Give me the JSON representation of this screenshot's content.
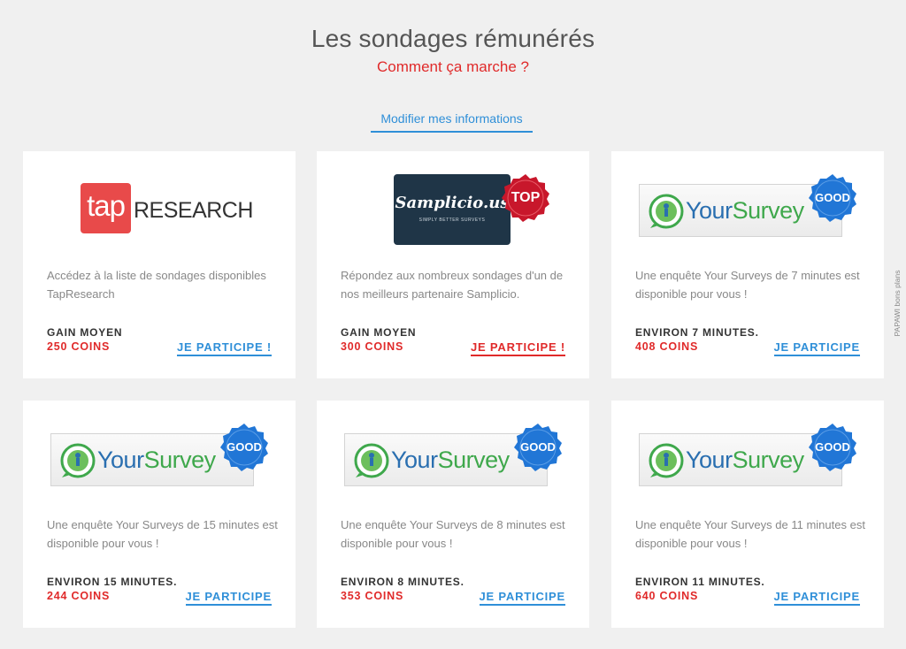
{
  "header": {
    "title": "Les sondages rémunérés",
    "how_link": "Comment ça marche ?",
    "modify_link": "Modifier mes informations"
  },
  "side_brand": "PAPAWI bons plans",
  "colors": {
    "accent_blue": "#2f8fd8",
    "accent_red": "#e02a2a",
    "badge_blue": "#2176d6",
    "badge_red": "#c8172b"
  },
  "cards": [
    {
      "logo": {
        "type": "tap",
        "box_text": "tap",
        "text": "RESEARCH"
      },
      "description": "Accédez à la liste de sondages disponibles TapResearch",
      "label": "GAIN MOYEN",
      "coins": "250 COINS",
      "cta": "JE PARTICIPE !"
    },
    {
      "logo": {
        "type": "samplicio",
        "name": "Samplicio.us",
        "tagline": "SIMPLY BETTER SURVEYS",
        "badge": "TOP"
      },
      "description": "Répondez aux nombreux sondages d'un de nos meilleurs partenaire Samplicio.",
      "label": "GAIN MOYEN",
      "coins": "300 COINS",
      "cta": "JE PARTICIPE !"
    },
    {
      "logo": {
        "type": "yoursurveys",
        "your": "Your",
        "survey": "Survey",
        "badge": "GOOD"
      },
      "description": "Une enquête Your Surveys de 7 minutes est disponible pour vous !",
      "label": "ENVIRON 7 MINUTES.",
      "coins": "408 COINS",
      "cta": "JE PARTICIPE"
    },
    {
      "logo": {
        "type": "yoursurveys",
        "your": "Your",
        "survey": "Survey",
        "badge": "GOOD"
      },
      "description": "Une enquête Your Surveys de 15 minutes est disponible pour vous !",
      "label": "ENVIRON 15 MINUTES.",
      "coins": "244 COINS",
      "cta": "JE PARTICIPE"
    },
    {
      "logo": {
        "type": "yoursurveys",
        "your": "Your",
        "survey": "Survey",
        "badge": "GOOD"
      },
      "description": "Une enquête Your Surveys de 8 minutes est disponible pour vous !",
      "label": "ENVIRON 8 MINUTES.",
      "coins": "353 COINS",
      "cta": "JE PARTICIPE"
    },
    {
      "logo": {
        "type": "yoursurveys",
        "your": "Your",
        "survey": "Survey",
        "badge": "GOOD"
      },
      "description": "Une enquête Your Surveys de 11 minutes est disponible pour vous !",
      "label": "ENVIRON 11 MINUTES.",
      "coins": "640 COINS",
      "cta": "JE PARTICIPE"
    }
  ]
}
